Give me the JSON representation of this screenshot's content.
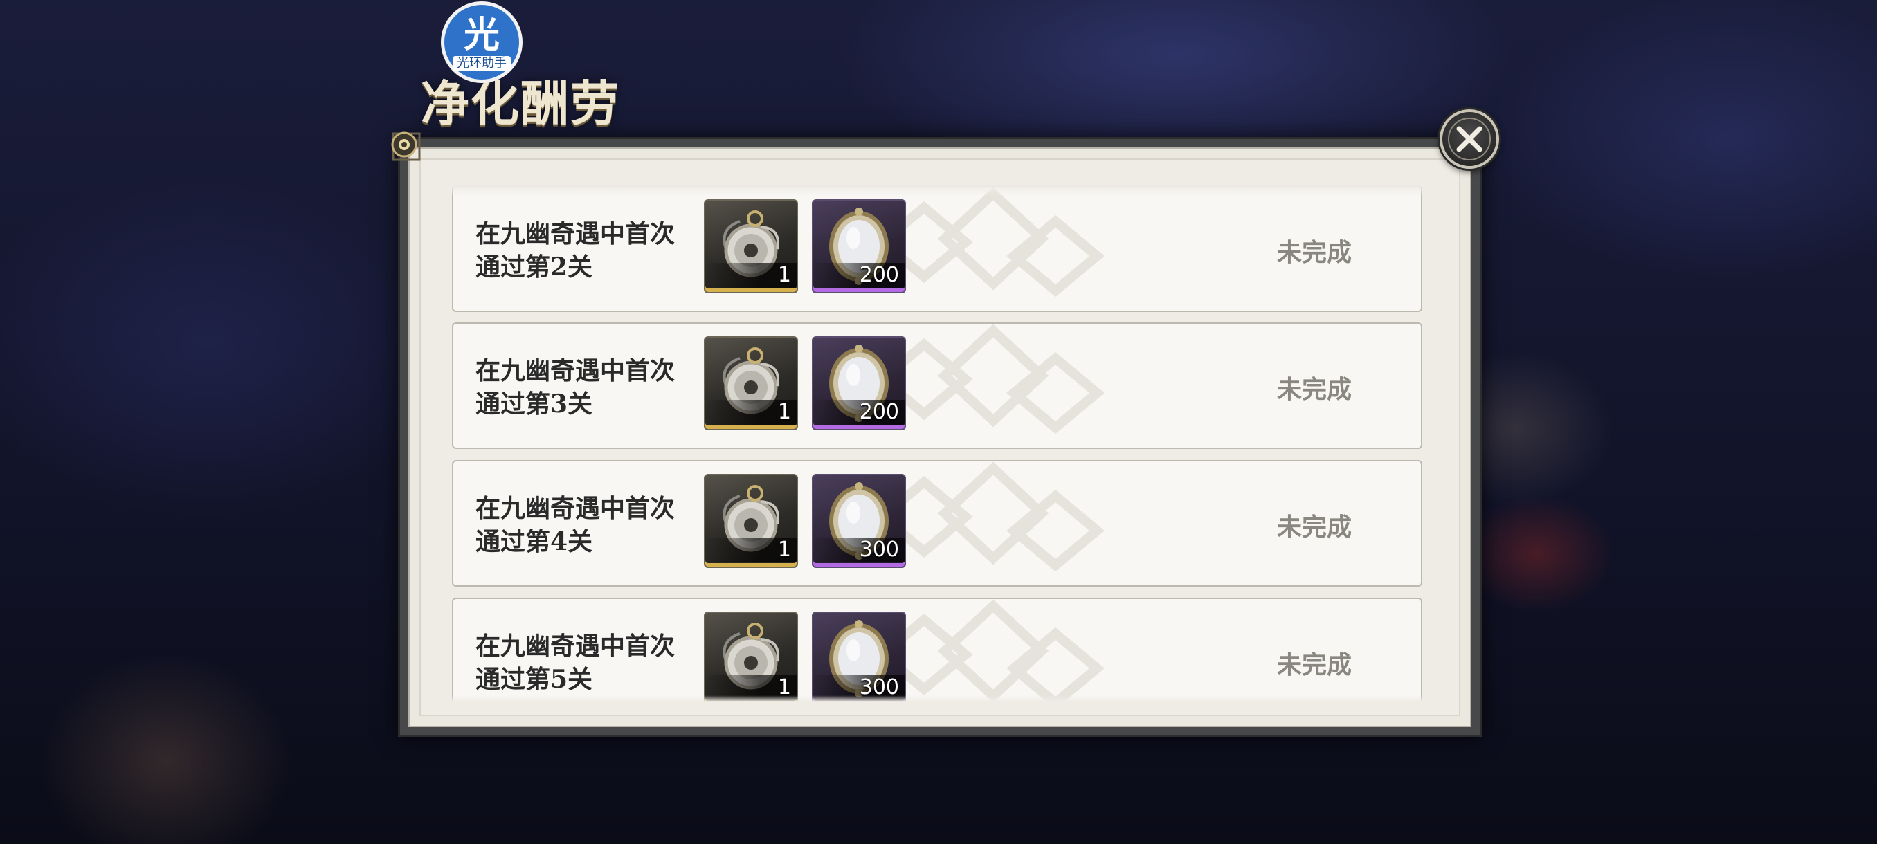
{
  "logo": {
    "glyph": "光",
    "label": "光环助手"
  },
  "dialog": {
    "title": "净化酬劳",
    "close_icon": "close-icon"
  },
  "colors": {
    "panel_bg": "#efece5",
    "row_bg": "#f8f7f4",
    "status_text": "#8a8781",
    "gold_rarity": "#d7b04e",
    "purple_rarity": "#b26be3"
  },
  "tasks": [
    {
      "line1": "在九幽奇遇中首次",
      "line2": "通过第2关",
      "rewards": [
        {
          "icon": "pocket-watch-icon",
          "rarity": "gold",
          "qty": "1"
        },
        {
          "icon": "mirror-icon",
          "rarity": "purple",
          "qty": "200"
        }
      ],
      "status": "未完成"
    },
    {
      "line1": "在九幽奇遇中首次",
      "line2": "通过第3关",
      "rewards": [
        {
          "icon": "pocket-watch-icon",
          "rarity": "gold",
          "qty": "1"
        },
        {
          "icon": "mirror-icon",
          "rarity": "purple",
          "qty": "200"
        }
      ],
      "status": "未完成"
    },
    {
      "line1": "在九幽奇遇中首次",
      "line2": "通过第4关",
      "rewards": [
        {
          "icon": "pocket-watch-icon",
          "rarity": "gold",
          "qty": "1"
        },
        {
          "icon": "mirror-icon",
          "rarity": "purple",
          "qty": "300"
        }
      ],
      "status": "未完成"
    },
    {
      "line1": "在九幽奇遇中首次",
      "line2": "通过第5关",
      "rewards": [
        {
          "icon": "pocket-watch-icon",
          "rarity": "gold",
          "qty": "1"
        },
        {
          "icon": "mirror-icon",
          "rarity": "purple",
          "qty": "300"
        }
      ],
      "status": "未完成"
    }
  ]
}
